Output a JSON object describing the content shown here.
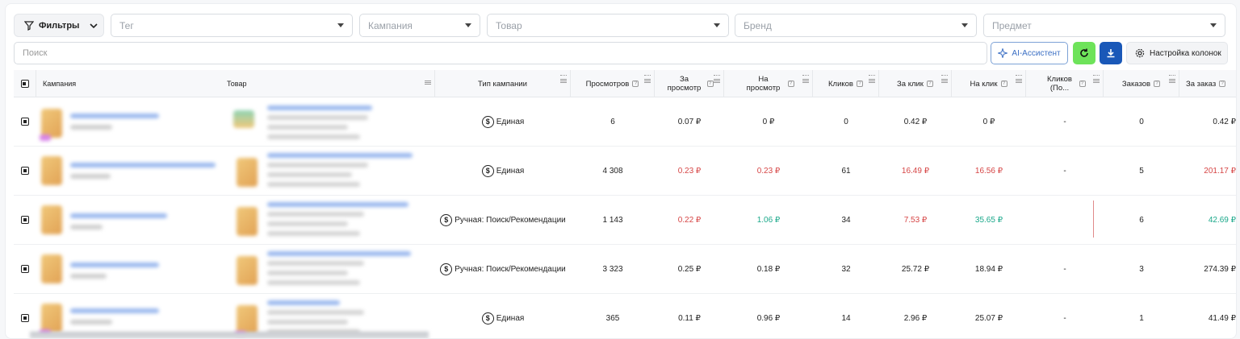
{
  "toolbar": {
    "filters_label": "Фильтры",
    "tag_placeholder": "Тег",
    "campaign_placeholder": "Кампания",
    "product_placeholder": "Товар",
    "brand_placeholder": "Бренд",
    "subject_placeholder": "Предмет",
    "search_placeholder": "Поиск",
    "ai_label": "AI-Ассистент",
    "columns_label": "Настройка колонок"
  },
  "table": {
    "headers": {
      "campaign": "Кампания",
      "product": "Товар",
      "type": "Тип кампании",
      "views": "Просмотров",
      "per_view": "За просмотр",
      "on_view": "На просмотр",
      "clicks": "Кликов",
      "per_click": "За клик",
      "on_click": "На клик",
      "clicks_po": "Кликов (По...",
      "orders": "Заказов",
      "per_order": "За заказ"
    },
    "rows": [
      {
        "type": "Единая",
        "views": "6",
        "per_view": "0.07 ₽",
        "on_view": "0 ₽",
        "clicks": "0",
        "per_click": "0.42 ₽",
        "on_click": "0 ₽",
        "clicks_po": "-",
        "orders": "0",
        "per_order": "0.42 ₽"
      },
      {
        "type": "Единая",
        "views": "4 308",
        "per_view": "0.23 ₽",
        "on_view": "0.23 ₽",
        "clicks": "61",
        "per_click": "16.49 ₽",
        "on_click": "16.56 ₽",
        "clicks_po": "-",
        "orders": "5",
        "per_order": "201.17 ₽"
      },
      {
        "type": "Ручная: Поиск/Рекомендации",
        "views": "1 143",
        "per_view": "0.22 ₽",
        "on_view": "1.06 ₽",
        "clicks": "34",
        "per_click": "7.53 ₽",
        "on_click": "35.65 ₽",
        "clicks_po": "",
        "orders": "6",
        "per_order": "42.69 ₽"
      },
      {
        "type": "Ручная: Поиск/Рекомендации",
        "views": "3 323",
        "per_view": "0.25 ₽",
        "on_view": "0.18 ₽",
        "clicks": "32",
        "per_click": "25.72 ₽",
        "on_click": "18.94 ₽",
        "clicks_po": "-",
        "orders": "3",
        "per_order": "274.39 ₽"
      },
      {
        "type": "Единая",
        "views": "365",
        "per_view": "0.11 ₽",
        "on_view": "0.96 ₽",
        "clicks": "14",
        "per_click": "2.96 ₽",
        "on_click": "25.07 ₽",
        "clicks_po": "-",
        "orders": "1",
        "per_order": "41.49 ₽"
      }
    ]
  },
  "colors": {
    "red": "#d64545",
    "green": "#1aa88a",
    "refresh": "#6ee35a",
    "download": "#1a58b8"
  }
}
